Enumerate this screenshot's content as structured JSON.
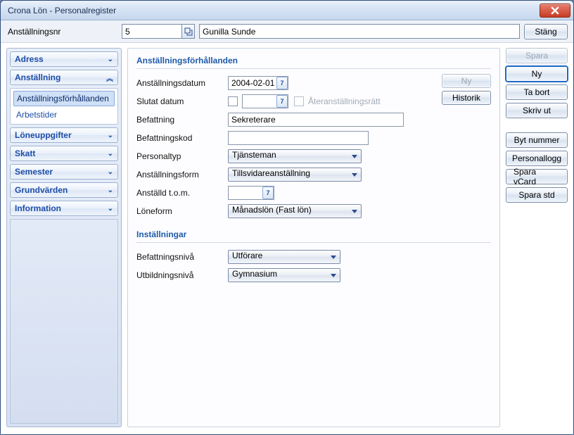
{
  "window": {
    "title": "Crona Lön - Personalregister"
  },
  "top": {
    "label": "Anställningsnr",
    "emp_no": "5",
    "emp_name": "Gunilla Sunde",
    "close_btn": "Stäng"
  },
  "sidebar": {
    "adress": "Adress",
    "anstallning": "Anställning",
    "anstallning_items": [
      "Anställningsförhållanden",
      "Arbetstider"
    ],
    "loneuppgifter": "Löneuppgifter",
    "skatt": "Skatt",
    "semester": "Semester",
    "grundvarden": "Grundvärden",
    "information": "Information"
  },
  "form": {
    "section1": "Anställningsförhållanden",
    "anst_datum_l": "Anställningsdatum",
    "anst_datum_v": "2004-02-01",
    "slutat_l": "Slutat datum",
    "ateranst_l": "Återanställningsrätt",
    "befattning_l": "Befattning",
    "befattning_v": "Sekreterare",
    "befkod_l": "Befattningskod",
    "befkod_v": "",
    "ptyp_l": "Personaltyp",
    "ptyp_v": "Tjänsteman",
    "aform_l": "Anställningsform",
    "aform_v": "Tillsvidareanställning",
    "atom_l": "Anställd t.o.m.",
    "loneform_l": "Löneform",
    "loneform_v": "Månadslön (Fast lön)",
    "section2": "Inställningar",
    "befn_l": "Befattningsnivå",
    "befn_v": "Utförare",
    "utb_l": "Utbildningsnivå",
    "utb_v": "Gymnasium",
    "ny_btn": "Ny",
    "hist_btn": "Historik"
  },
  "actions": {
    "spara": "Spara",
    "ny": "Ny",
    "tabort": "Ta bort",
    "skrivut": "Skriv ut",
    "bytnummer": "Byt nummer",
    "personallogg": "Personallogg",
    "sparavcard": "Spara vCard",
    "sparastd": "Spara std"
  }
}
